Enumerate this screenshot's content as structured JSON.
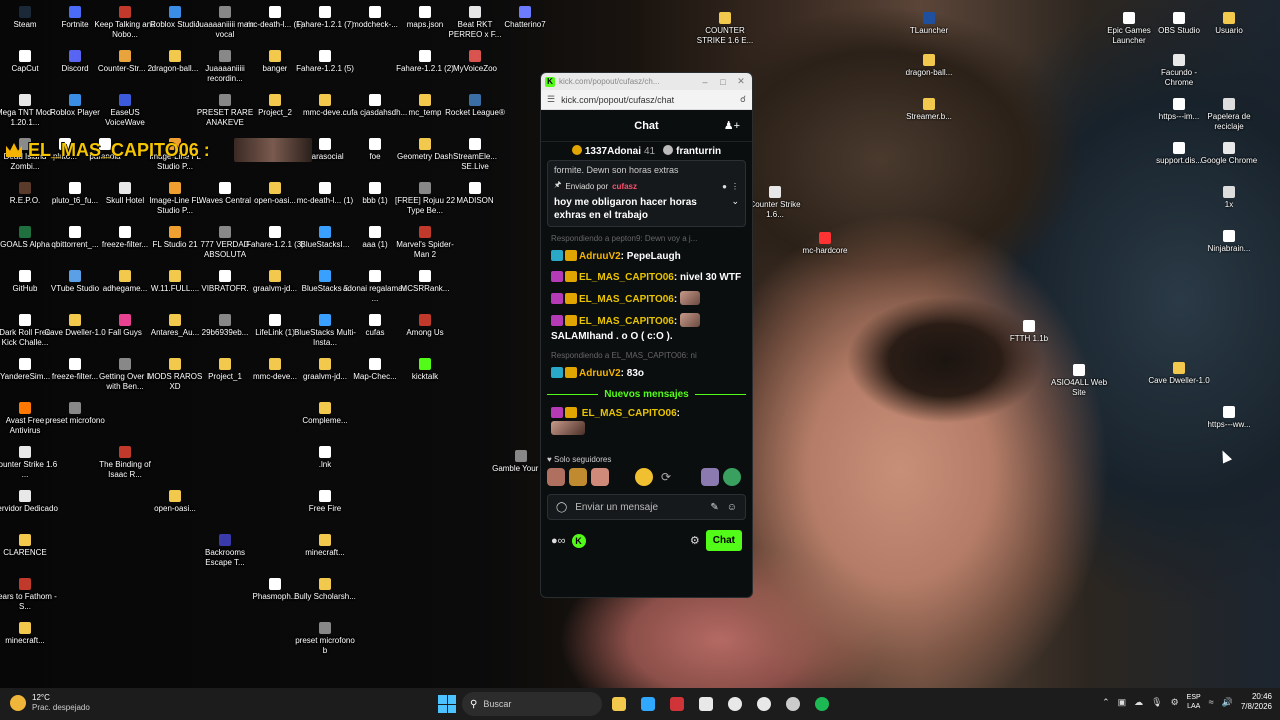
{
  "desktop": {
    "icons": [
      {
        "label": "Steam",
        "color": "#1b2838"
      },
      {
        "label": "Fortnite",
        "color": "#4a6cf7"
      },
      {
        "label": "Keep Talking and Nobo...",
        "color": "#c0392b"
      },
      {
        "label": "Roblox Studio",
        "color": "#3a8ee6"
      },
      {
        "label": "Juaaaaniiiii main vocal",
        "color": "#888888"
      },
      {
        "label": "mc-death-l... (1)",
        "color": "#ffffff"
      },
      {
        "label": "Fahare-1.2.1 (7)",
        "color": "#ffffff"
      },
      {
        "label": "modcheck-...",
        "color": "#ffffff"
      },
      {
        "label": "maps.json",
        "color": "#ffffff"
      },
      {
        "label": "Beat RKT PERREO x F...",
        "color": "#e6e6e6"
      },
      {
        "label": "Chatterino7",
        "color": "#6c7bff"
      },
      {
        "label": "CapCut",
        "color": "#ffffff"
      },
      {
        "label": "Discord",
        "color": "#5865f2"
      },
      {
        "label": "Counter-Str... 2",
        "color": "#e8a33c"
      },
      {
        "label": "dragon-ball...",
        "color": "#f2c94c"
      },
      {
        "label": "Juaaaaniiiii recordin...",
        "color": "#888888"
      },
      {
        "label": "banger",
        "color": "#f2c94c"
      },
      {
        "label": "Fahare-1.2.1 (5)",
        "color": "#ffffff"
      },
      {
        "label": "Fahare-1.2.1 (2)",
        "color": "#ffffff"
      },
      {
        "label": "MyVoiceZoo",
        "color": "#d9534f"
      },
      {
        "label": "Mega TNT Mod-1.20.1...",
        "color": "#e8e8e8"
      },
      {
        "label": "Roblox Player",
        "color": "#3a8ee6"
      },
      {
        "label": "EaseUS VoiceWave",
        "color": "#3b5bdb"
      },
      {
        "label": "PRESET RARE ANAKEVE",
        "color": "#888888"
      },
      {
        "label": "Project_2",
        "color": "#f2c94c"
      },
      {
        "label": "mmc-deve...",
        "color": "#f2c94c"
      },
      {
        "label": "cufa cjasdahsdh...",
        "color": "#ffffff"
      },
      {
        "label": "mc_temp",
        "color": "#f2c94c"
      },
      {
        "label": "Rocket League®",
        "color": "#3a6ea5"
      },
      {
        "label": "Dead Island Zombi...",
        "color": "#8a8a8a"
      },
      {
        "label": "pluto...",
        "color": "#ffffff"
      },
      {
        "label": "paranoia",
        "color": "#ffffff"
      },
      {
        "label": "Image-Line FL Studio P...",
        "color": "#f0a030"
      },
      {
        "label": "Parasocial",
        "color": "#ffffff"
      },
      {
        "label": "foe",
        "color": "#ffffff"
      },
      {
        "label": "Geometry Dash",
        "color": "#f2c94c"
      },
      {
        "label": "StreamEle... SE.Live",
        "color": "#ffffff"
      },
      {
        "label": "R.E.P.O.",
        "color": "#5a3a2a"
      },
      {
        "label": "pluto_t6_fu...",
        "color": "#ffffff"
      },
      {
        "label": "Skull Hotel",
        "color": "#e8e8e8"
      },
      {
        "label": "Image-Line FL Studio P...",
        "color": "#f0a030"
      },
      {
        "label": "Waves Central",
        "color": "#ffffff"
      },
      {
        "label": "open-oasi...",
        "color": "#f2c94c"
      },
      {
        "label": "mc-death-l... (1)",
        "color": "#ffffff"
      },
      {
        "label": "bbb (1)",
        "color": "#ffffff"
      },
      {
        "label": "[FREE] Rojuu 22 Type Be...",
        "color": "#888888"
      },
      {
        "label": "MADISON",
        "color": "#ffffff"
      },
      {
        "label": "GOALS Alpha",
        "color": "#1f6f3f"
      },
      {
        "label": "qbittorrent_...",
        "color": "#ffffff"
      },
      {
        "label": "freeze-filter...",
        "color": "#ffffff"
      },
      {
        "label": "FL Studio 21",
        "color": "#f0a030"
      },
      {
        "label": "777 VERDAD ABSOLUTA",
        "color": "#888888"
      },
      {
        "label": "Fahare-1.2.1 (3)",
        "color": "#ffffff"
      },
      {
        "label": "BlueStacksI...",
        "color": "#3aa0ff"
      },
      {
        "label": "aaa (1)",
        "color": "#ffffff"
      },
      {
        "label": "Marvel's Spider-Man 2",
        "color": "#c0392b"
      },
      {
        "label": "GitHub",
        "color": "#ffffff"
      },
      {
        "label": "VTube Studio",
        "color": "#5aa0e6"
      },
      {
        "label": "adhegame...",
        "color": "#f2c94c"
      },
      {
        "label": "W.11.FULL....",
        "color": "#f2c94c"
      },
      {
        "label": "VIBRATOFR.",
        "color": "#ffffff"
      },
      {
        "label": "graalvm-jd...",
        "color": "#f2c94c"
      },
      {
        "label": "BlueStacks 5",
        "color": "#3aa0ff"
      },
      {
        "label": "adonai regalamae ...",
        "color": "#ffffff"
      },
      {
        "label": "MCSRRank...",
        "color": "#ffffff"
      },
      {
        "label": "Dark Roll Free Kick Challe...",
        "color": "#ffffff"
      },
      {
        "label": "Cave Dweller-1.0",
        "color": "#f2c94c"
      },
      {
        "label": "Fall Guys",
        "color": "#e84393"
      },
      {
        "label": "Antares_Au...",
        "color": "#f2c94c"
      },
      {
        "label": "29b6939eb...",
        "color": "#888888"
      },
      {
        "label": "LifeLink (1)",
        "color": "#ffffff"
      },
      {
        "label": "BlueStacks Multi-Insta...",
        "color": "#3aa0ff"
      },
      {
        "label": "cufas",
        "color": "#ffffff"
      },
      {
        "label": "Among Us",
        "color": "#c0392b"
      },
      {
        "label": "YandereSim...",
        "color": "#ffffff"
      },
      {
        "label": "freeze-filter...",
        "color": "#ffffff"
      },
      {
        "label": "Getting Over It with Ben...",
        "color": "#888888"
      },
      {
        "label": "MODS RAROS XD",
        "color": "#f2c94c"
      },
      {
        "label": "Project_1",
        "color": "#f2c94c"
      },
      {
        "label": "mmc-deve...",
        "color": "#f2c94c"
      },
      {
        "label": "graalvm-jd...",
        "color": "#f2c94c"
      },
      {
        "label": "Map-Chec...",
        "color": "#ffffff"
      },
      {
        "label": "kicktalk",
        "color": "#53fc18"
      },
      {
        "label": "Avast Free Antivirus",
        "color": "#ff7800"
      },
      {
        "label": "preset microfono",
        "color": "#888888"
      },
      {
        "label": "Compleme...",
        "color": "#f2c94c"
      },
      {
        "label": "Counter Strike 1.6 ...",
        "color": "#e8e8e8"
      },
      {
        "label": "The Binding of Isaac R...",
        "color": "#c0392b"
      },
      {
        "label": ".lnk",
        "color": "#ffffff"
      },
      {
        "label": "Gamble Your Fe",
        "color": "#888888"
      },
      {
        "label": "Servidor Dedicado",
        "color": "#e8e8e8"
      },
      {
        "label": "open-oasi...",
        "color": "#f2c94c"
      },
      {
        "label": "Free Fire",
        "color": "#ffffff"
      },
      {
        "label": "CLARENCE",
        "color": "#f2c94c"
      },
      {
        "label": "Backrooms Escape T...",
        "color": "#3a3aaa"
      },
      {
        "label": "minecraft...",
        "color": "#f2c94c"
      },
      {
        "label": "Fears to Fathom - S...",
        "color": "#c0392b"
      },
      {
        "label": "Phasmoph...",
        "color": "#ffffff"
      },
      {
        "label": "Bully Scholarsh...",
        "color": "#f2c94c"
      },
      {
        "label": "minecraft...",
        "color": "#f2c94c"
      },
      {
        "label": "preset microfono b",
        "color": "#888888"
      },
      {
        "label": "COUNTER STRIKE 1.6 E...",
        "color": "#f2c94c"
      },
      {
        "label": "TLauncher",
        "color": "#1f4f9f"
      },
      {
        "label": "dragon-ball...",
        "color": "#f2c94c"
      },
      {
        "label": "Streamer.b...",
        "color": "#f2c94c"
      },
      {
        "label": "Counter Strike 1.6...",
        "color": "#e8e8e8"
      },
      {
        "label": "mc-hardcore",
        "color": "#ff3333"
      },
      {
        "label": "FTTH 1.1b",
        "color": "#ffffff"
      },
      {
        "label": "ASIO4ALL Web Site",
        "color": "#ffffff"
      },
      {
        "label": "Epic Games Launcher",
        "color": "#ffffff"
      },
      {
        "label": "OBS Studio",
        "color": "#ffffff"
      },
      {
        "label": "Usuario",
        "color": "#f2c94c"
      },
      {
        "label": "Facundo - Chrome",
        "color": "#e8e8e8"
      },
      {
        "label": "https---im...",
        "color": "#ffffff"
      },
      {
        "label": "Papelera de reciclaje",
        "color": "#dddddd"
      },
      {
        "label": "support.dis...",
        "color": "#ffffff"
      },
      {
        "label": "Google Chrome",
        "color": "#e8e8e8"
      },
      {
        "label": "1x",
        "color": "#dddddd"
      },
      {
        "label": "Ninjabrain...",
        "color": "#ffffff"
      },
      {
        "label": "Cave Dweller-1.0",
        "color": "#f2c94c"
      },
      {
        "label": "https---ww...",
        "color": "#ffffff"
      }
    ]
  },
  "overlay": {
    "name": "EL_MAS_CAPITO06 :"
  },
  "window": {
    "title": "kick.com/popout/cufasz/ch...",
    "url": "kick.com/popout/cufasz/chat"
  },
  "chat": {
    "header": "Chat",
    "top_gifters": [
      {
        "name": "1337Adonai",
        "count": "41",
        "color": "#e0a500"
      },
      {
        "name": "franturrin",
        "count": "",
        "color": "#bbbbbb"
      }
    ],
    "pinned": {
      "cut_text": "formite. Dewn  son horas extras",
      "sent_by_label": "Enviado por",
      "sent_by_user": "cufasz",
      "message": "hoy me obligaron hacer horas exhras en el trabajo"
    },
    "messages": [
      {
        "reply": "Respondiendo a pepton9: Dewn voy a j...",
        "user": "AdruuV2",
        "text": "PepeLaugh",
        "badges": [
          "b-tier",
          "b-crown"
        ]
      },
      {
        "reply": "",
        "user": "EL_MAS_CAPITO06",
        "text": "nivel 30 WTF",
        "badges": [
          "b-sub",
          "b-crown"
        ]
      },
      {
        "reply": "",
        "user": "EL_MAS_CAPITO06",
        "text": "",
        "badges": [
          "b-sub",
          "b-crown"
        ],
        "emote": true
      },
      {
        "reply": "",
        "user": "EL_MAS_CAPITO06",
        "text": "SALAMIhand . o O ( c:O ).",
        "badges": [
          "b-sub",
          "b-crown"
        ],
        "emote": true
      },
      {
        "reply": "Respondiendo a EL_MAS_CAPITO06: ni",
        "user": "AdruuV2",
        "text": "83o",
        "badges": [
          "b-tier",
          "b-crown"
        ]
      }
    ],
    "new_messages_label": "Nuevos mensajes",
    "last_message": {
      "user": "EL_MAS_CAPITO06",
      "text": ""
    },
    "followers_only_label": "Solo seguidores",
    "input_placeholder": "Enviar un mensaje",
    "send_button": "Chat"
  },
  "taskbar": {
    "weather_temp": "12°C",
    "weather_desc": "Prac. despejado",
    "search_label": "Buscar",
    "language": "ESP",
    "language_sub": "LAA",
    "time": "20:46",
    "date": "7/8/2026",
    "pinned_apps": [
      {
        "name": "file-explorer",
        "color": "#f2c94c"
      },
      {
        "name": "photoshop",
        "color": "#31a8ff"
      },
      {
        "name": "wps",
        "color": "#d13438"
      },
      {
        "name": "store",
        "color": "#e8e8e8"
      },
      {
        "name": "chrome",
        "color": "#e8e8e8"
      },
      {
        "name": "chrome-2",
        "color": "#e8e8e8"
      },
      {
        "name": "obs",
        "color": "#cccccc"
      },
      {
        "name": "spotify",
        "color": "#1db954"
      }
    ]
  }
}
